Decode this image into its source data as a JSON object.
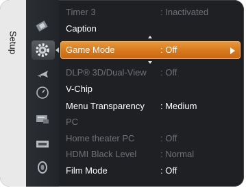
{
  "sidebar": {
    "title": "Setup",
    "icons": [
      {
        "name": "picture-icon"
      },
      {
        "name": "setup-gear-icon"
      },
      {
        "name": "sound-icon"
      },
      {
        "name": "clock-icon"
      },
      {
        "name": "channel-list-icon"
      },
      {
        "name": "input-icon"
      },
      {
        "name": "support-icon"
      }
    ]
  },
  "menu": {
    "items": [
      {
        "label": "Timer 3",
        "value": ": Inactivated",
        "state": "disabled"
      },
      {
        "label": "Caption",
        "value": "",
        "state": "enabled"
      },
      {
        "label": "Game Mode",
        "value": ": Off",
        "state": "selected"
      },
      {
        "label": "DLP® 3D/Dual-View",
        "value": ": Off",
        "state": "disabled"
      },
      {
        "label": "V-Chip",
        "value": "",
        "state": "enabled"
      },
      {
        "label": "Menu Transparency",
        "value": ": Medium",
        "state": "enabled"
      },
      {
        "label": "PC",
        "value": "",
        "state": "disabled"
      },
      {
        "label": "Home theater PC",
        "value": ": Off",
        "state": "disabled"
      },
      {
        "label": "HDMI Black Level",
        "value": ": Normal",
        "state": "disabled"
      },
      {
        "label": "Film Mode",
        "value": ": Off",
        "state": "enabled"
      }
    ]
  },
  "colors": {
    "highlight": "#d8771c",
    "background": "#1e2024",
    "disabled_text": "#6e7276"
  }
}
